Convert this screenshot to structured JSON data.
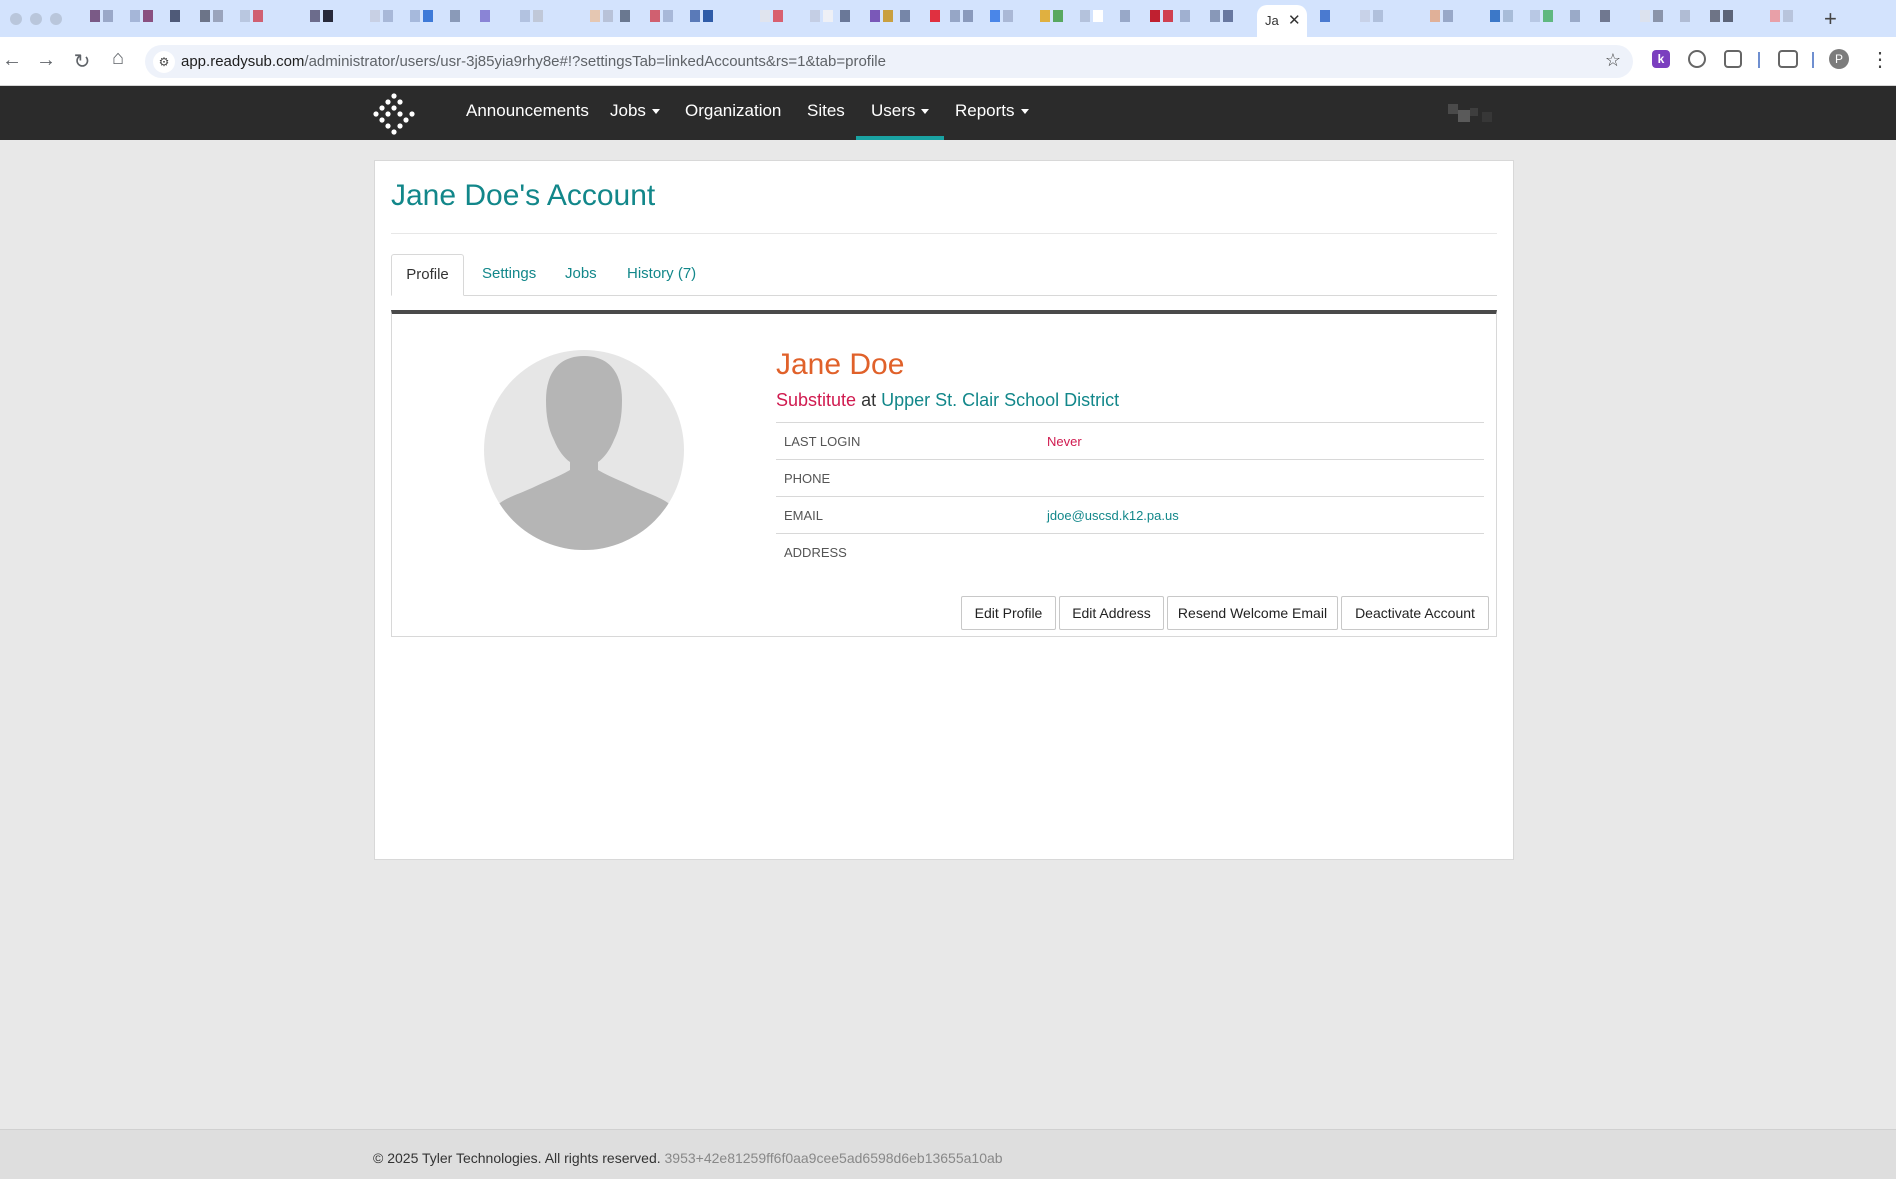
{
  "browser": {
    "active_tab_title": "Ja",
    "url_host": "app.readysub.com",
    "url_path": "/administrator/users/usr-3j85yia9rhy8e#!?settingsTab=linkedAccounts&rs=1&tab=profile",
    "profile_initial": "P",
    "extension_initial": "k"
  },
  "nav": {
    "items": [
      "Announcements",
      "Jobs",
      "Organization",
      "Sites",
      "Users",
      "Reports"
    ],
    "active": "Users"
  },
  "page": {
    "title": "Jane Doe's Account",
    "tabs": [
      "Profile",
      "Settings",
      "Jobs",
      "History (7)"
    ],
    "active_tab": "Profile"
  },
  "profile": {
    "name": "Jane Doe",
    "role": "Substitute",
    "role_connector": "at",
    "district": "Upper St. Clair School District",
    "fields": [
      {
        "label": "LAST LOGIN",
        "value": "Never"
      },
      {
        "label": "PHONE",
        "value": ""
      },
      {
        "label": "EMAIL",
        "value": "jdoe@uscsd.k12.pa.us"
      },
      {
        "label": "ADDRESS",
        "value": ""
      }
    ],
    "buttons": [
      "Edit Profile",
      "Edit Address",
      "Resend Welcome Email",
      "Deactivate Account"
    ]
  },
  "footer": {
    "copyright": "© 2025 Tyler Technologies. All rights reserved.",
    "build": "3953+42e81259ff6f0aa9cee5ad6598d6eb13655a10ab"
  },
  "colors": {
    "accent_teal": "#12878a",
    "name_orange": "#e0612a",
    "role_red": "#d01a4f",
    "nav_bg": "#2b2b2b"
  }
}
